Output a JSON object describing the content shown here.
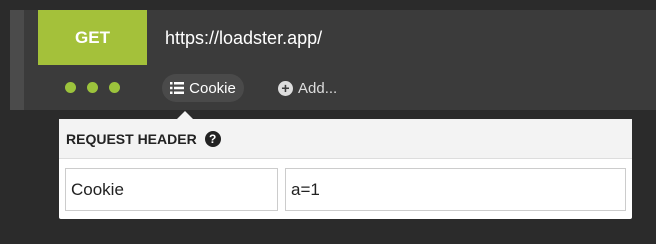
{
  "request": {
    "method": "GET",
    "url": "https://loadster.app/",
    "cookie_chip_label": "Cookie",
    "add_label": "Add..."
  },
  "popover": {
    "title": "REQUEST HEADER",
    "header_name": "Cookie",
    "header_value": "a=1"
  },
  "icons": {
    "more": "more-dots-icon",
    "list": "list-icon",
    "add": "plus-circle-icon",
    "help": "question-circle-icon"
  },
  "colors": {
    "accent": "#a4c13a",
    "dots": "#9cc33c",
    "bar_bg": "#3b3b3b",
    "page_bg": "#2b2b2b"
  }
}
